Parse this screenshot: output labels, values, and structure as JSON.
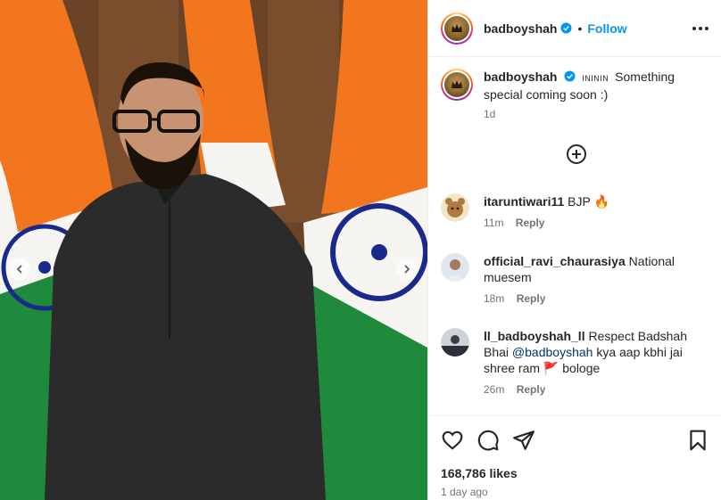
{
  "post": {
    "author": {
      "username": "badboyshah",
      "verified": true,
      "follow_label": "Follow",
      "separator": "•"
    },
    "caption": {
      "username": "badboyshah",
      "tag": "INININ",
      "text": "Something special coming soon :)",
      "age": "1d"
    },
    "comments": [
      {
        "username": "itaruntiwari11",
        "text": "BJP",
        "emoji": "🔥",
        "age": "11m",
        "reply_label": "Reply"
      },
      {
        "username": "official_ravi_chaurasiya",
        "text": "National muesem",
        "age": "18m",
        "reply_label": "Reply"
      },
      {
        "username": "ll_badboyshah_ll",
        "text_before": "Respect Badshah Bhai",
        "mention": "@badboyshah",
        "text_after": "kya aap kbhi jai shree ram",
        "emoji": "🚩",
        "text_end": "bologe",
        "age": "26m",
        "reply_label": "Reply"
      }
    ],
    "likes": "168,786 likes",
    "posted": "1 day ago"
  },
  "icons": {
    "more": "more-options-icon",
    "load_more": "add-circle-icon",
    "like": "heart-icon",
    "comment": "comment-icon",
    "share": "send-icon",
    "save": "bookmark-icon",
    "prev": "chevron-left-icon",
    "next": "chevron-right-icon"
  },
  "colors": {
    "link_blue": "#0095f6",
    "verified_blue": "#0095f6",
    "saffron": "#f2761e",
    "green": "#1f8a3b",
    "chakra_navy": "#1a2a8c"
  }
}
